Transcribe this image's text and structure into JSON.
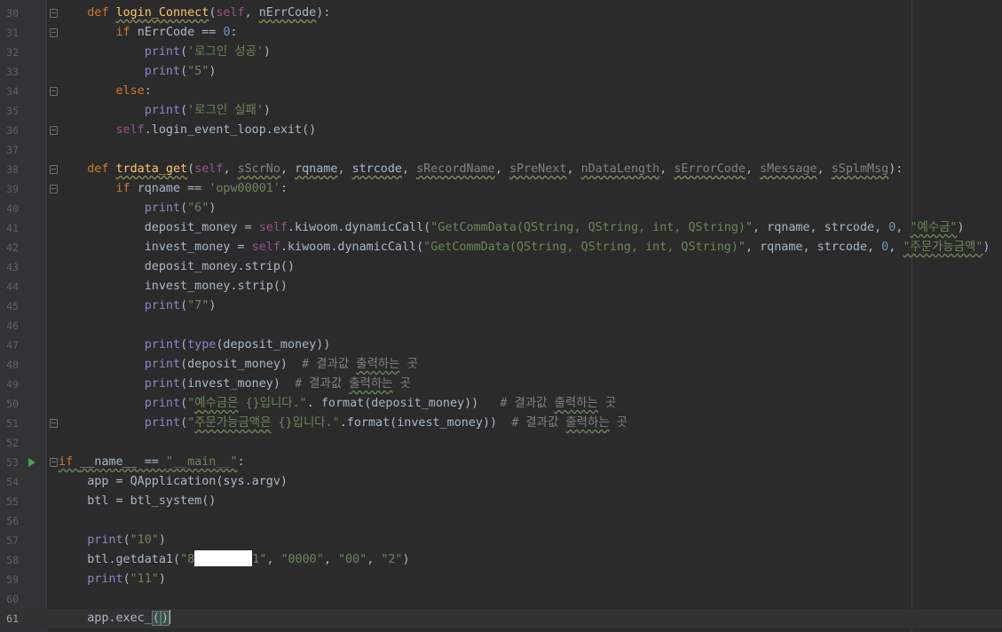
{
  "editor": {
    "language": "python",
    "current_line": 61,
    "run_marker_line": 53,
    "colors": {
      "background": "#2b2b2b",
      "gutter": "#313335",
      "keyword": "#cc7832",
      "function": "#ffc66d",
      "self": "#94558d",
      "string": "#6a8759",
      "number": "#6897bb",
      "comment": "#808080",
      "builtin": "#8888c6",
      "text": "#a9b7c6"
    },
    "lines": [
      {
        "n": "30",
        "tokens": [
          {
            "t": "    "
          },
          {
            "t": "def ",
            "c": "kw"
          },
          {
            "t": "login_Connect",
            "c": "fn",
            "u": "y"
          },
          {
            "t": "("
          },
          {
            "t": "self",
            "c": "slf"
          },
          {
            "t": ", "
          },
          {
            "t": "nErrCode",
            "u": "y"
          },
          {
            "t": "):"
          }
        ]
      },
      {
        "n": "31",
        "tokens": [
          {
            "t": "        "
          },
          {
            "t": "if ",
            "c": "kw"
          },
          {
            "t": "nErrCode == "
          },
          {
            "t": "0",
            "c": "num"
          },
          {
            "t": ":"
          }
        ]
      },
      {
        "n": "32",
        "tokens": [
          {
            "t": "            "
          },
          {
            "t": "print",
            "c": "bi"
          },
          {
            "t": "("
          },
          {
            "t": "'로그인 성공'",
            "c": "str"
          },
          {
            "t": ")"
          }
        ]
      },
      {
        "n": "33",
        "tokens": [
          {
            "t": "            "
          },
          {
            "t": "print",
            "c": "bi"
          },
          {
            "t": "("
          },
          {
            "t": "\"5\"",
            "c": "str"
          },
          {
            "t": ")"
          }
        ]
      },
      {
        "n": "34",
        "tokens": [
          {
            "t": "        "
          },
          {
            "t": "else",
            "c": "kw"
          },
          {
            "t": ":"
          }
        ]
      },
      {
        "n": "35",
        "tokens": [
          {
            "t": "            "
          },
          {
            "t": "print",
            "c": "bi"
          },
          {
            "t": "("
          },
          {
            "t": "'로그인 실패'",
            "c": "str"
          },
          {
            "t": ")"
          }
        ]
      },
      {
        "n": "36",
        "tokens": [
          {
            "t": "        "
          },
          {
            "t": "self",
            "c": "slf"
          },
          {
            "t": ".login_event_loop.exit()"
          }
        ]
      },
      {
        "n": "37",
        "tokens": []
      },
      {
        "n": "38",
        "tokens": [
          {
            "t": "    "
          },
          {
            "t": "def ",
            "c": "kw"
          },
          {
            "t": "trdata_get",
            "c": "fn",
            "u": "y"
          },
          {
            "t": "("
          },
          {
            "t": "self",
            "c": "slf"
          },
          {
            "t": ", "
          },
          {
            "t": "sScrNo",
            "c": "cmt",
            "u": "y"
          },
          {
            "t": ", "
          },
          {
            "t": "rqname",
            "u": "y"
          },
          {
            "t": ", "
          },
          {
            "t": "strcode",
            "u": "y"
          },
          {
            "t": ", "
          },
          {
            "t": "sRecordName",
            "c": "cmt",
            "u": "y"
          },
          {
            "t": ", "
          },
          {
            "t": "sPreNext",
            "c": "cmt",
            "u": "y"
          },
          {
            "t": ", "
          },
          {
            "t": "nDataLength",
            "c": "cmt",
            "u": "y"
          },
          {
            "t": ", "
          },
          {
            "t": "sErrorCode",
            "c": "cmt",
            "u": "y"
          },
          {
            "t": ", "
          },
          {
            "t": "sMessage",
            "c": "cmt",
            "u": "y"
          },
          {
            "t": ", "
          },
          {
            "t": "sSplmMsg",
            "c": "cmt",
            "u": "y"
          },
          {
            "t": "):"
          }
        ]
      },
      {
        "n": "39",
        "tokens": [
          {
            "t": "        "
          },
          {
            "t": "if ",
            "c": "kw"
          },
          {
            "t": "rqname == "
          },
          {
            "t": "'opw00001'",
            "c": "str"
          },
          {
            "t": ":"
          }
        ]
      },
      {
        "n": "40",
        "tokens": [
          {
            "t": "            "
          },
          {
            "t": "print",
            "c": "bi"
          },
          {
            "t": "("
          },
          {
            "t": "\"6\"",
            "c": "str"
          },
          {
            "t": ")"
          }
        ]
      },
      {
        "n": "41",
        "tokens": [
          {
            "t": "            deposit_money = "
          },
          {
            "t": "self",
            "c": "slf"
          },
          {
            "t": ".kiwoom.dynamicCall("
          },
          {
            "t": "\"GetCommData(QString, QString, int, QString)\"",
            "c": "str"
          },
          {
            "t": ", rqname, strcode, "
          },
          {
            "t": "0",
            "c": "num"
          },
          {
            "t": ", "
          },
          {
            "t": "\"예수금\"",
            "c": "str",
            "u": "g"
          },
          {
            "t": ")"
          }
        ]
      },
      {
        "n": "42",
        "tokens": [
          {
            "t": "            invest_money = "
          },
          {
            "t": "self",
            "c": "slf"
          },
          {
            "t": ".kiwoom.dynamicCall("
          },
          {
            "t": "\"GetCommData(QString, QString, int, QString)\"",
            "c": "str"
          },
          {
            "t": ", rqname, strcode, "
          },
          {
            "t": "0",
            "c": "num"
          },
          {
            "t": ", "
          },
          {
            "t": "\"주문가능금액\"",
            "c": "str",
            "u": "g"
          },
          {
            "t": ")"
          }
        ]
      },
      {
        "n": "43",
        "tokens": [
          {
            "t": "            deposit_money.strip()"
          }
        ]
      },
      {
        "n": "44",
        "tokens": [
          {
            "t": "            invest_money.strip()"
          }
        ]
      },
      {
        "n": "45",
        "tokens": [
          {
            "t": "            "
          },
          {
            "t": "print",
            "c": "bi"
          },
          {
            "t": "("
          },
          {
            "t": "\"7\"",
            "c": "str"
          },
          {
            "t": ")"
          }
        ]
      },
      {
        "n": "46",
        "tokens": []
      },
      {
        "n": "47",
        "tokens": [
          {
            "t": "            "
          },
          {
            "t": "print",
            "c": "bi"
          },
          {
            "t": "("
          },
          {
            "t": "type",
            "c": "bi"
          },
          {
            "t": "(deposit_money))"
          }
        ]
      },
      {
        "n": "48",
        "tokens": [
          {
            "t": "            "
          },
          {
            "t": "print",
            "c": "bi"
          },
          {
            "t": "(deposit_money)  "
          },
          {
            "t": "# 결과값 ",
            "c": "cmt"
          },
          {
            "t": "출력하는",
            "c": "cmt",
            "u": "g"
          },
          {
            "t": " 곳",
            "c": "cmt"
          }
        ]
      },
      {
        "n": "49",
        "tokens": [
          {
            "t": "            "
          },
          {
            "t": "print",
            "c": "bi"
          },
          {
            "t": "(invest_money)  "
          },
          {
            "t": "# 결과값 ",
            "c": "cmt"
          },
          {
            "t": "출력하는",
            "c": "cmt",
            "u": "g"
          },
          {
            "t": " 곳",
            "c": "cmt"
          }
        ]
      },
      {
        "n": "50",
        "tokens": [
          {
            "t": "            "
          },
          {
            "t": "print",
            "c": "bi"
          },
          {
            "t": "("
          },
          {
            "t": "\"",
            "c": "str"
          },
          {
            "t": "예수금은",
            "c": "str",
            "u": "g"
          },
          {
            "t": " {}입니다.\"",
            "c": "str"
          },
          {
            "t": ". format(deposit_money))   "
          },
          {
            "t": "# 결과값 ",
            "c": "cmt"
          },
          {
            "t": "출력하는",
            "c": "cmt",
            "u": "g"
          },
          {
            "t": " 곳",
            "c": "cmt"
          }
        ]
      },
      {
        "n": "51",
        "tokens": [
          {
            "t": "            "
          },
          {
            "t": "print",
            "c": "bi"
          },
          {
            "t": "("
          },
          {
            "t": "\"",
            "c": "str"
          },
          {
            "t": "주문가능금액은",
            "c": "str",
            "u": "g"
          },
          {
            "t": " {}입니다.\"",
            "c": "str"
          },
          {
            "t": ".format(invest_money))  "
          },
          {
            "t": "# 결과값 ",
            "c": "cmt"
          },
          {
            "t": "출력하는",
            "c": "cmt",
            "u": "g"
          },
          {
            "t": " 곳",
            "c": "cmt"
          }
        ]
      },
      {
        "n": "52",
        "tokens": []
      },
      {
        "n": "53",
        "tokens": [
          {
            "t": "if ",
            "c": "kw",
            "u": "g"
          },
          {
            "t": "__name__ == ",
            "u": "g"
          },
          {
            "t": "\"__main__\"",
            "c": "str",
            "u": "g"
          },
          {
            "t": ":"
          }
        ]
      },
      {
        "n": "54",
        "tokens": [
          {
            "t": "    app = QApplication(sys.argv)"
          }
        ]
      },
      {
        "n": "55",
        "tokens": [
          {
            "t": "    btl = btl_system()"
          }
        ]
      },
      {
        "n": "56",
        "tokens": []
      },
      {
        "n": "57",
        "tokens": [
          {
            "t": "    "
          },
          {
            "t": "print",
            "c": "bi"
          },
          {
            "t": "("
          },
          {
            "t": "\"10\"",
            "c": "str"
          },
          {
            "t": ")"
          }
        ]
      },
      {
        "n": "58",
        "tokens": [
          {
            "t": "    btl.getdata1("
          },
          {
            "t": "\"8",
            "c": "str"
          },
          {
            "r": true
          },
          {
            "t": "1\"",
            "c": "str"
          },
          {
            "t": ", "
          },
          {
            "t": "\"0000\"",
            "c": "str"
          },
          {
            "t": ", "
          },
          {
            "t": "\"00\"",
            "c": "str"
          },
          {
            "t": ", "
          },
          {
            "t": "\"2\"",
            "c": "str"
          },
          {
            "t": ")"
          }
        ]
      },
      {
        "n": "59",
        "tokens": [
          {
            "t": "    "
          },
          {
            "t": "print",
            "c": "bi"
          },
          {
            "t": "("
          },
          {
            "t": "\"11\"",
            "c": "str"
          },
          {
            "t": ")"
          }
        ]
      },
      {
        "n": "60",
        "tokens": []
      },
      {
        "n": "61",
        "tokens": [
          {
            "t": "    app.exec_"
          },
          {
            "t": "(",
            "m": true
          },
          {
            "t": ")",
            "m": true
          },
          {
            "caret": true
          }
        ]
      }
    ],
    "fold_lines": [
      "30",
      "31",
      "34",
      "36",
      "38",
      "39",
      "51",
      "53"
    ]
  }
}
